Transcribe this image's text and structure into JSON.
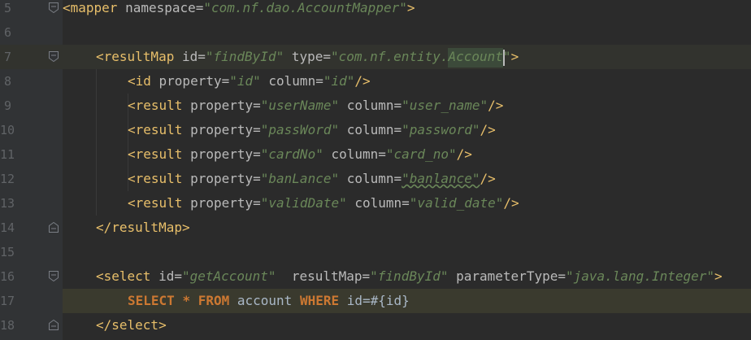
{
  "lines": [
    {
      "num": "5",
      "tokens": [
        [
          "t",
          "<mapper "
        ],
        [
          "a",
          "namespace="
        ],
        [
          "s",
          "\"com.nf.dao.AccountMapper\""
        ],
        [
          "t",
          ">"
        ]
      ]
    },
    {
      "num": "6",
      "tokens": []
    },
    {
      "num": "7",
      "tokens": [
        [
          "t",
          "<resultMap "
        ],
        [
          "a",
          "id="
        ],
        [
          "s",
          "\"findById\""
        ],
        [
          "a",
          " type="
        ],
        [
          "s",
          "\"com.nf.entity.Account\""
        ],
        [
          "t",
          ">"
        ]
      ]
    },
    {
      "num": "8",
      "tokens": [
        [
          "t",
          "<id "
        ],
        [
          "a",
          "property="
        ],
        [
          "s",
          "\"id\""
        ],
        [
          "a",
          " column="
        ],
        [
          "s",
          "\"id\""
        ],
        [
          "t",
          "/>"
        ]
      ]
    },
    {
      "num": "9",
      "tokens": [
        [
          "t",
          "<result "
        ],
        [
          "a",
          "property="
        ],
        [
          "s",
          "\"userName\""
        ],
        [
          "a",
          " column="
        ],
        [
          "s",
          "\"user_name\""
        ],
        [
          "t",
          "/>"
        ]
      ]
    },
    {
      "num": "10",
      "tokens": [
        [
          "t",
          "<result "
        ],
        [
          "a",
          "property="
        ],
        [
          "s",
          "\"passWord\""
        ],
        [
          "a",
          " column="
        ],
        [
          "s",
          "\"password\""
        ],
        [
          "t",
          "/>"
        ]
      ]
    },
    {
      "num": "11",
      "tokens": [
        [
          "t",
          "<result "
        ],
        [
          "a",
          "property="
        ],
        [
          "s",
          "\"cardNo\""
        ],
        [
          "a",
          " column="
        ],
        [
          "s",
          "\"card_no\""
        ],
        [
          "t",
          "/>"
        ]
      ]
    },
    {
      "num": "12",
      "tokens": [
        [
          "t",
          "<result "
        ],
        [
          "a",
          "property="
        ],
        [
          "s",
          "\"banLance\""
        ],
        [
          "a",
          " column="
        ],
        [
          "s",
          "\"banlance\""
        ],
        [
          "t",
          "/>"
        ]
      ]
    },
    {
      "num": "13",
      "tokens": [
        [
          "t",
          "<result "
        ],
        [
          "a",
          "property="
        ],
        [
          "s",
          "\"validDate\""
        ],
        [
          "a",
          " column="
        ],
        [
          "s",
          "\"valid_date\""
        ],
        [
          "t",
          "/>"
        ]
      ]
    },
    {
      "num": "14",
      "tokens": [
        [
          "t",
          "</resultMap>"
        ]
      ]
    },
    {
      "num": "15",
      "tokens": []
    },
    {
      "num": "16",
      "tokens": [
        [
          "t",
          "<select "
        ],
        [
          "a",
          "id="
        ],
        [
          "s",
          "\"getAccount\""
        ],
        [
          "a",
          "  resultMap="
        ],
        [
          "s",
          "\"findById\""
        ],
        [
          "a",
          " parameterType="
        ],
        [
          "s",
          "\"java.lang.Integer\""
        ],
        [
          "t",
          ">"
        ]
      ]
    },
    {
      "num": "17",
      "tokens": [
        [
          "k",
          "SELECT "
        ],
        [
          "k",
          "* "
        ],
        [
          "k",
          "FROM "
        ],
        [
          "p",
          "account "
        ],
        [
          "k",
          "WHERE "
        ],
        [
          "p",
          "id=#{id}"
        ]
      ]
    },
    {
      "num": "18",
      "tokens": [
        [
          "t",
          "</select>"
        ]
      ]
    }
  ],
  "colors": {
    "background": "#2b2b2b",
    "tag": "#e8bf6a",
    "attribute": "#bababa",
    "string": "#6a8759",
    "sql_keyword": "#cc7832",
    "plain": "#a9b7c6",
    "line_number": "#606366"
  }
}
